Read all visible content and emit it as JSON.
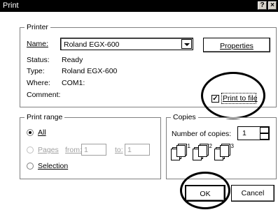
{
  "window": {
    "title": "Print",
    "help_glyph": "?",
    "close_glyph": "×"
  },
  "printer": {
    "group_label": "Printer",
    "name_label": "Name:",
    "name_value": "Roland EGX-600",
    "properties_label": "Properties",
    "status_label": "Status:",
    "status_value": "Ready",
    "type_label": "Type:",
    "type_value": "Roland EGX-600",
    "where_label": "Where:",
    "where_value": "COM1:",
    "comment_label": "Comment:",
    "print_to_file_label": "Print to file",
    "print_to_file_checked": true
  },
  "print_range": {
    "group_label": "Print range",
    "all_label": "All",
    "pages_label": "Pages",
    "from_label": "from:",
    "from_value": "1",
    "to_label": "to:",
    "to_value": "1",
    "selection_label": "Selection",
    "selected": "all"
  },
  "copies": {
    "group_label": "Copies",
    "number_label": "Number of copies:",
    "number_value": "1",
    "collate_pages": [
      "1",
      "1",
      "2",
      "2",
      "3",
      "3"
    ]
  },
  "buttons": {
    "ok_label": "OK",
    "cancel_label": "Cancel"
  }
}
